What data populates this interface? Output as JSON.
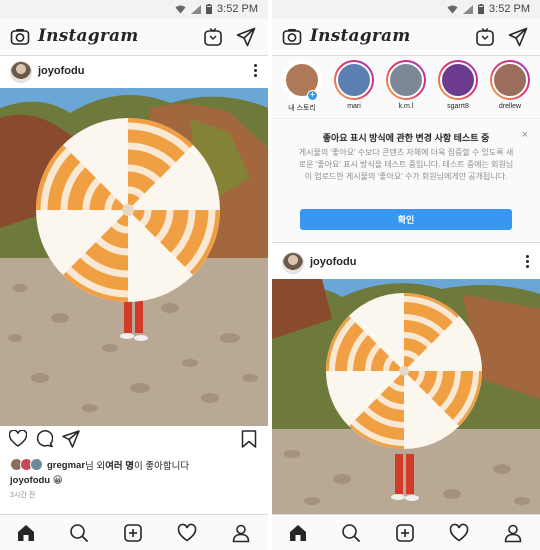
{
  "status_bar": {
    "time": "3:52 PM"
  },
  "app": {
    "logo_text": "Instagram"
  },
  "post": {
    "username": "joyofodu",
    "likes": {
      "liker": "gregmar",
      "connector": " 님 외 ",
      "others": "여러 명",
      "suffix": "이 좋아합니다"
    },
    "caption_user": "joyofodu",
    "caption_emoji": "😀",
    "time_ago": "3시간 전"
  },
  "stories": [
    {
      "label": "내 스토리",
      "own": true,
      "color": "#b07a5a"
    },
    {
      "label": "mari",
      "own": false,
      "color": "#5a7fb0"
    },
    {
      "label": "k.m.l",
      "own": false,
      "color": "#7d8896"
    },
    {
      "label": "sgarrt8",
      "own": false,
      "color": "#6b3b8f"
    },
    {
      "label": "drellew",
      "own": false,
      "color": "#9a6d5d"
    }
  ],
  "notice": {
    "title": "좋아요 표시 방식에 관한 변경 사항 테스트 중",
    "body": "게시물의 '좋아요' 수보다 콘텐츠 자체에 더욱 집중할 수 있도록 새로운 '좋아요' 표시 방식을 테스트 중입니다. 테스트 중에는 회원님이 업로드한 게시물의 '좋아요' 수가 회원님에게만 공개됩니다.",
    "confirm_label": "확인",
    "close_label": "×"
  },
  "colors": {
    "accent": "#3897f0",
    "umbrella_stripe": "#f0a043",
    "sky": "#6aa6d6"
  }
}
